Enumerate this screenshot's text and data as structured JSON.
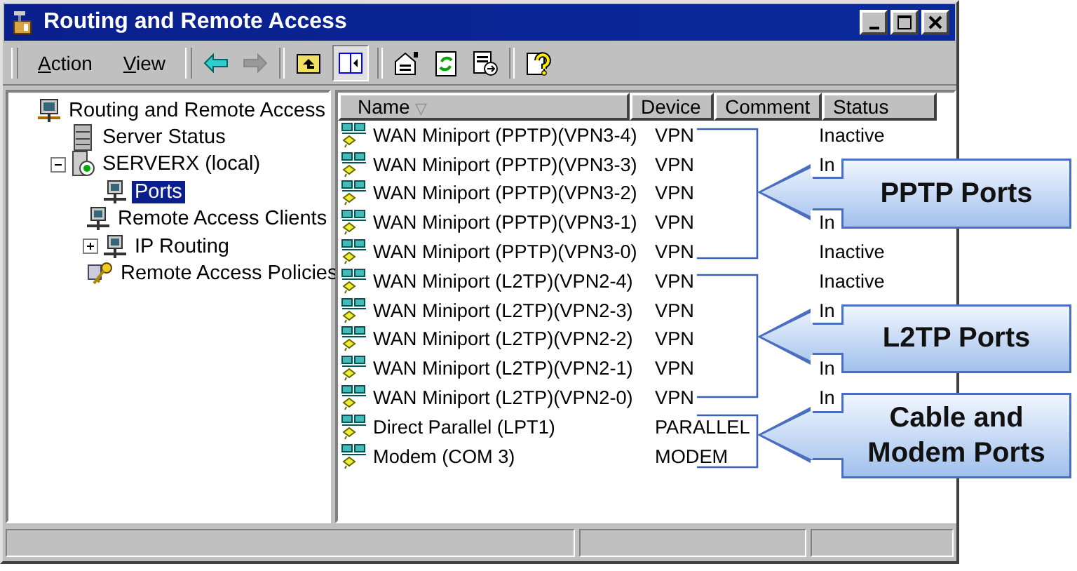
{
  "window": {
    "title": "Routing and Remote Access"
  },
  "menu": [
    {
      "label": "Action"
    },
    {
      "label": "View"
    }
  ],
  "tree": [
    {
      "label": "Routing and Remote Access",
      "kind": "console",
      "selected": false,
      "children": [
        {
          "label": "Server Status",
          "kind": "status",
          "selected": false
        },
        {
          "label": "SERVERX (local)",
          "kind": "server",
          "selected": false,
          "expanded": true,
          "children": [
            {
              "label": "Ports",
              "kind": "node",
              "selected": true
            },
            {
              "label": "Remote Access Clients",
              "kind": "node",
              "selected": false
            },
            {
              "label": "IP Routing",
              "kind": "node",
              "selected": false,
              "expanded": false
            },
            {
              "label": "Remote Access Policies",
              "kind": "policies",
              "selected": false
            }
          ]
        }
      ]
    }
  ],
  "table": {
    "columns": [
      {
        "label": "Name",
        "sort_icon": "▽"
      },
      {
        "label": "Device"
      },
      {
        "label": "Comment"
      },
      {
        "label": "Status"
      }
    ],
    "rows": [
      {
        "name": "WAN Miniport (PPTP)(VPN3-4)",
        "device": "VPN",
        "status": "Inactive"
      },
      {
        "name": "WAN Miniport (PPTP)(VPN3-3)",
        "device": "VPN",
        "status": "In"
      },
      {
        "name": "WAN Miniport (PPTP)(VPN3-2)",
        "device": "VPN"
      },
      {
        "name": "WAN Miniport (PPTP)(VPN3-1)",
        "device": "VPN",
        "status": "In"
      },
      {
        "name": "WAN Miniport (PPTP)(VPN3-0)",
        "device": "VPN",
        "status": "Inactive"
      },
      {
        "name": "WAN Miniport (L2TP)(VPN2-4)",
        "device": "VPN",
        "status": "Inactive"
      },
      {
        "name": "WAN Miniport (L2TP)(VPN2-3)",
        "device": "VPN",
        "status": "In"
      },
      {
        "name": "WAN Miniport (L2TP)(VPN2-2)",
        "device": "VPN"
      },
      {
        "name": "WAN Miniport (L2TP)(VPN2-1)",
        "device": "VPN",
        "status": "In"
      },
      {
        "name": "WAN Miniport (L2TP)(VPN2-0)",
        "device": "VPN",
        "status": "In"
      },
      {
        "name": "Direct Parallel (LPT1)",
        "device": "PARALLEL"
      },
      {
        "name": "Modem (COM 3)",
        "device": "MODEM"
      }
    ]
  },
  "annotations": [
    {
      "label": "PPTP Ports"
    },
    {
      "label": "L2TP Ports"
    },
    {
      "label": "Cable and Modem Ports"
    }
  ]
}
